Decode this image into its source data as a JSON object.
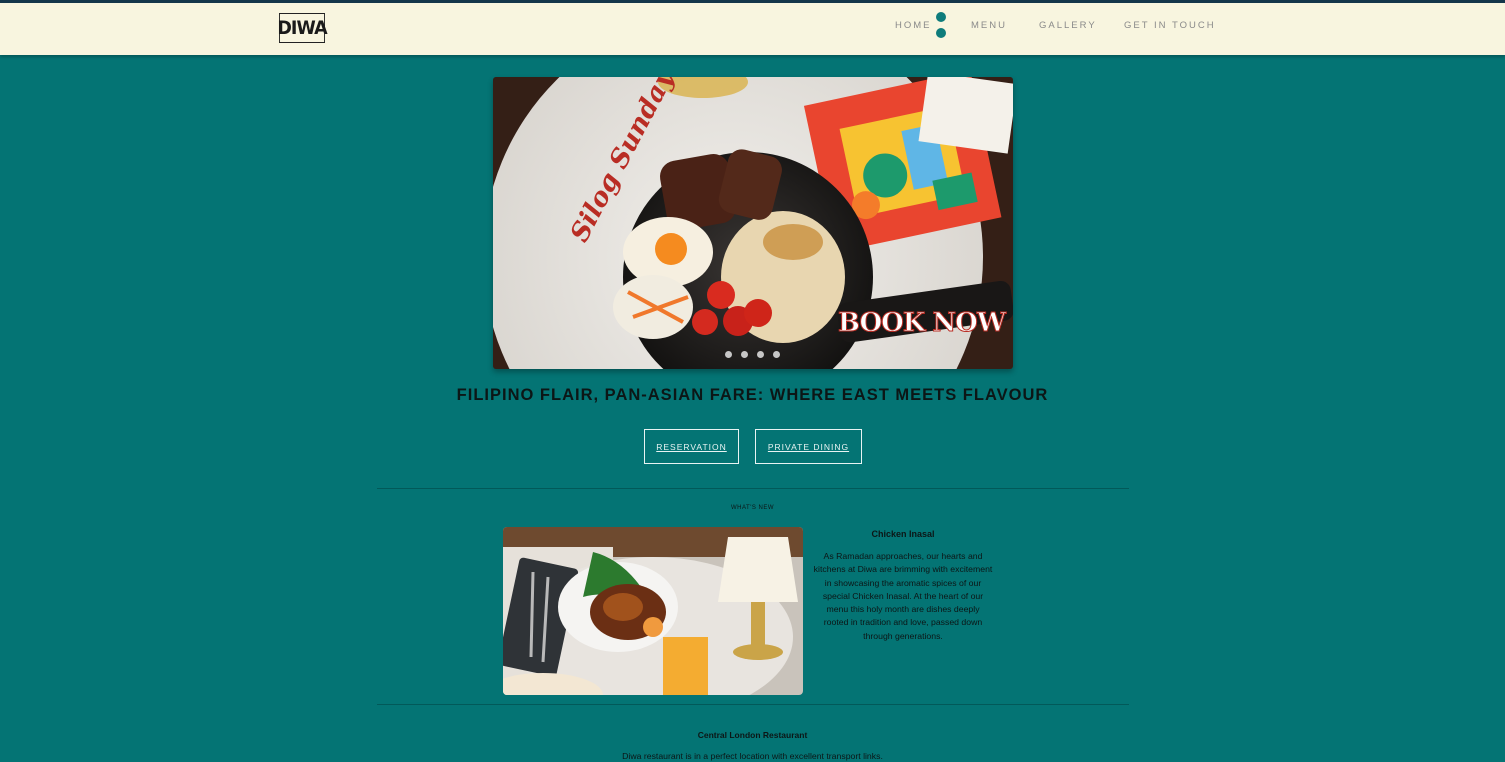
{
  "brand": {
    "logo_text": "DIWA"
  },
  "nav": {
    "items": [
      {
        "label": "HOME"
      },
      {
        "label": "MENU"
      },
      {
        "label": "GALLERY"
      },
      {
        "label": "GET IN TOUCH"
      }
    ]
  },
  "hero": {
    "banner_script": "Silog Sunday",
    "banner_cta": "BOOK NOW",
    "slide_count": 4
  },
  "headline": "FILIPINO FLAIR, PAN-ASIAN FARE: WHERE EAST MEETS FLAVOUR",
  "buttons": {
    "reservation": "RESERVATION",
    "private_dining": "PRIVATE DINING"
  },
  "whats_new": {
    "label": "WHAT'S NEW",
    "title": "Chicken Inasal",
    "body": "As Ramadan approaches, our hearts and kitchens at Diwa are brimming with excitement in showcasing the aromatic spices of our special Chicken Inasal. At the heart of our menu this holy month are dishes deeply rooted in tradition and love, passed down through generations."
  },
  "location": {
    "title": "Central London Restaurant",
    "body": "Diwa restaurant is in a perfect location with excellent transport links."
  },
  "colors": {
    "page_bg": "#047474",
    "topbar_bg": "#f8f5df",
    "topbar_border": "#14364a",
    "accent_dot": "#0e7c7b"
  }
}
